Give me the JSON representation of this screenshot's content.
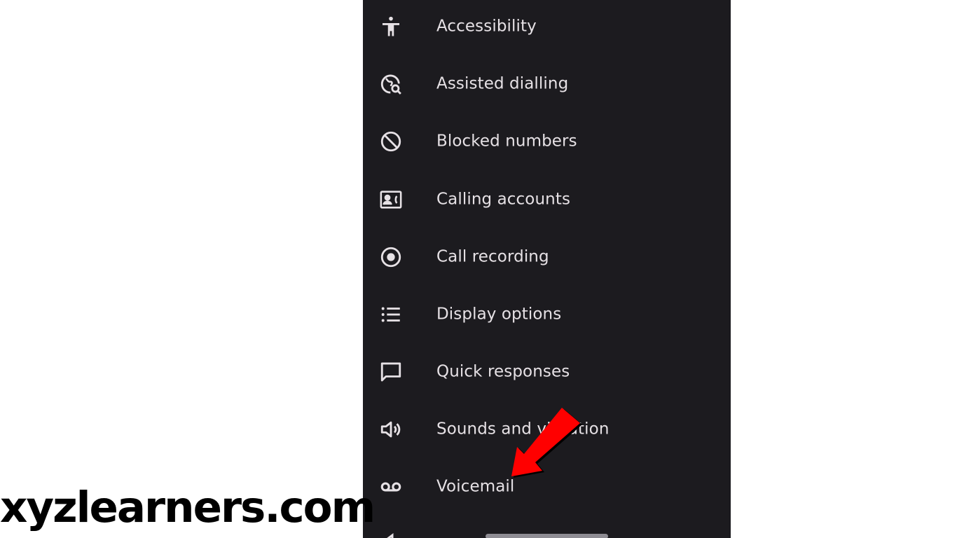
{
  "settings": {
    "items": [
      {
        "label": "Accessibility",
        "icon": "accessibility-icon"
      },
      {
        "label": "Assisted dialling",
        "icon": "assisted-dialling-icon"
      },
      {
        "label": "Blocked numbers",
        "icon": "block-icon"
      },
      {
        "label": "Calling accounts",
        "icon": "contact-phone-icon"
      },
      {
        "label": "Call recording",
        "icon": "record-icon"
      },
      {
        "label": "Display options",
        "icon": "list-icon"
      },
      {
        "label": "Quick responses",
        "icon": "chat-bubble-icon"
      },
      {
        "label": "Sounds and vibration",
        "icon": "volume-icon"
      },
      {
        "label": "Voicemail",
        "icon": "voicemail-icon"
      }
    ]
  },
  "watermark": {
    "text": "xyzlearners.com"
  },
  "colors": {
    "panel_background": "#1c1b1f",
    "text": "#e6e1e5",
    "icon": "#e6e1e5",
    "arrow": "#ff0000",
    "page_background": "#ffffff"
  }
}
